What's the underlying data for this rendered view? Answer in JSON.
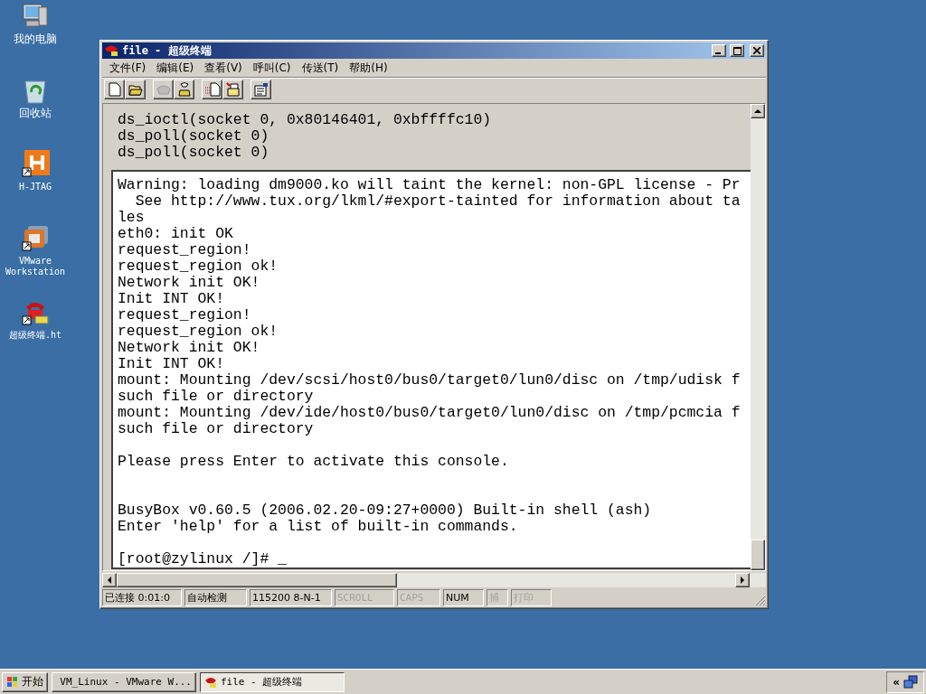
{
  "desktop_icons": [
    {
      "kind": "computer",
      "label": "我的电脑"
    },
    {
      "kind": "recycle",
      "label": "回收站"
    },
    {
      "kind": "hjtag",
      "label": "H-JTAG"
    },
    {
      "kind": "vmware",
      "label": "VMware Workstation"
    },
    {
      "kind": "phone",
      "label": "超级终端.ht"
    }
  ],
  "window": {
    "title": "file - 超级终端"
  },
  "menu": [
    "文件(F)",
    "编辑(E)",
    "查看(V)",
    "呼叫(C)",
    "传送(T)",
    "帮助(H)"
  ],
  "toolbar": [
    [
      {
        "kind": "new",
        "disabled": false
      },
      {
        "kind": "open",
        "disabled": false
      }
    ],
    [
      {
        "kind": "hangup",
        "disabled": true
      },
      {
        "kind": "dial",
        "disabled": false
      }
    ],
    [
      {
        "kind": "send",
        "disabled": false
      },
      {
        "kind": "receive",
        "disabled": false
      }
    ],
    [
      {
        "kind": "properties",
        "disabled": false
      }
    ]
  ],
  "scrollback": [
    "ds_ioctl(socket 0, 0x80146401, 0xbffffc10)",
    "ds_poll(socket 0)",
    "ds_poll(socket 0)"
  ],
  "console_blocks": [
    {
      "kind": "first",
      "lines": [
        "Warning: loading dm9000.ko will taint the kernel: non-GPL license - Pr",
        "  See http://www.tux.org/lkml/#export-tainted for information about ta",
        "les",
        "eth0: init OK",
        "request_region!",
        "request_region ok!",
        "Network init OK!",
        "Init INT OK!",
        "request_region!",
        "request_region ok!",
        "Network init OK!",
        "Init INT OK!",
        "mount: Mounting /dev/scsi/host0/bus0/target0/lun0/disc on /tmp/udisk f",
        "such file or directory",
        "mount: Mounting /dev/ide/host0/bus0/target0/lun0/disc on /tmp/pcmcia f",
        "such file or directory"
      ]
    },
    {
      "kind": "spaced",
      "lines": [
        "Please press Enter to activate this console."
      ]
    },
    {
      "kind": "wide_spaced",
      "lines": [
        "BusyBox v0.60.5 (2006.02.20-09:27+0000) Built-in shell (ash)",
        "Enter 'help' for a list of built-in commands."
      ]
    },
    {
      "kind": "spaced",
      "lines": [
        "[root@zylinux /]# _"
      ]
    }
  ],
  "status_bar": [
    {
      "text": "已连接 0:01:0",
      "on": true
    },
    {
      "text": "自动检测",
      "on": true
    },
    {
      "text": "115200 8-N-1",
      "on": true
    },
    {
      "text": "SCROLL",
      "on": false
    },
    {
      "text": "CAPS",
      "on": false
    },
    {
      "text": "NUM",
      "on": true
    },
    {
      "text": "捕",
      "on": false
    },
    {
      "text": "打印",
      "on": false
    }
  ],
  "taskbar": {
    "start": "开始",
    "tasks": [
      {
        "kind": "vmware",
        "label": "VM_Linux - VMware W...",
        "selected": false
      },
      {
        "kind": "phone",
        "label": "file - 超级终端",
        "selected": true
      }
    ],
    "tray": "«"
  }
}
